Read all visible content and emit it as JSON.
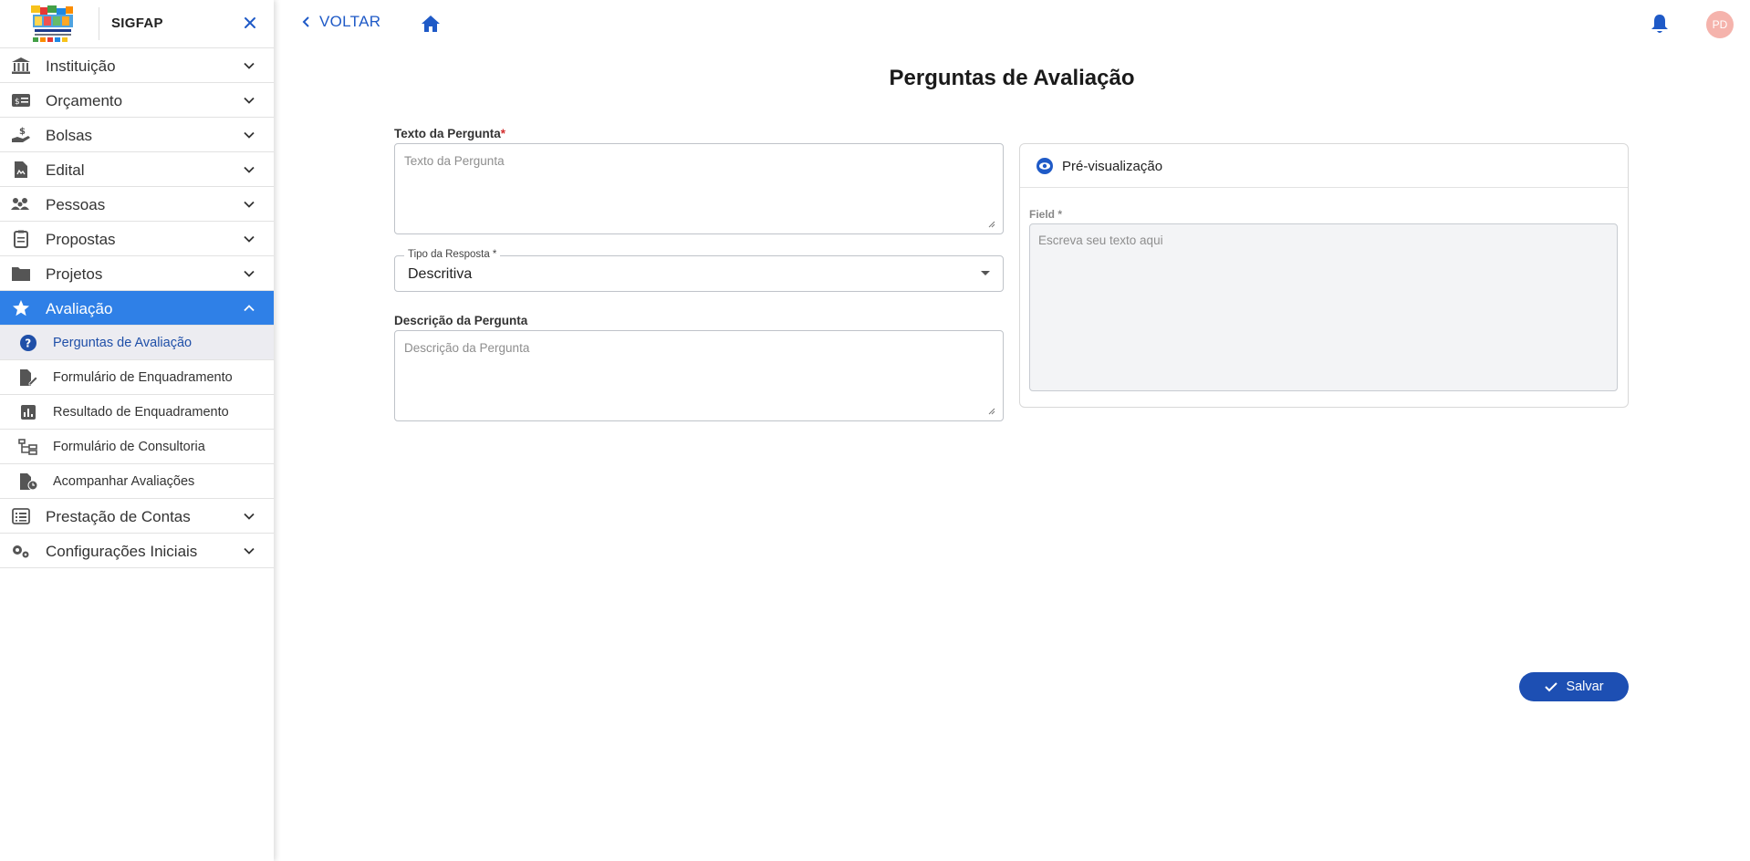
{
  "app": {
    "title": "SIGFAP"
  },
  "sidebar": {
    "items": [
      {
        "label": "Instituição",
        "icon": "institution-icon"
      },
      {
        "label": "Orçamento",
        "icon": "budget-icon"
      },
      {
        "label": "Bolsas",
        "icon": "scholarship-icon"
      },
      {
        "label": "Edital",
        "icon": "document-icon"
      },
      {
        "label": "Pessoas",
        "icon": "people-icon"
      },
      {
        "label": "Propostas",
        "icon": "proposal-icon"
      },
      {
        "label": "Projetos",
        "icon": "folder-icon"
      },
      {
        "label": "Avaliação",
        "icon": "star-icon",
        "active": true
      }
    ],
    "subitems": [
      {
        "label": "Perguntas de Avaliação",
        "icon": "question-icon",
        "active": true
      },
      {
        "label": "Formulário de Enquadramento",
        "icon": "file-edit-icon"
      },
      {
        "label": "Resultado de Enquadramento",
        "icon": "bar-chart-icon"
      },
      {
        "label": "Formulário de Consultoria",
        "icon": "tree-icon"
      },
      {
        "label": "Acompanhar Avaliações",
        "icon": "file-clock-icon"
      }
    ],
    "after_items": [
      {
        "label": "Prestação de Contas",
        "icon": "list-icon"
      },
      {
        "label": "Configurações Iniciais",
        "icon": "gears-icon"
      }
    ]
  },
  "topbar": {
    "back_label": "VOLTAR",
    "avatar_initials": "PD"
  },
  "page": {
    "title": "Perguntas de Avaliação"
  },
  "form": {
    "question_text": {
      "label": "Texto da Pergunta",
      "required_mark": "*",
      "placeholder": "Texto da Pergunta",
      "value": ""
    },
    "answer_type": {
      "label": "Tipo da Resposta *",
      "value": "Descritiva"
    },
    "question_description": {
      "label": "Descrição da Pergunta",
      "placeholder": "Descrição da Pergunta",
      "value": ""
    }
  },
  "preview": {
    "title": "Pré-visualização",
    "field_label": "Field *",
    "placeholder": "Escreva seu texto aqui"
  },
  "actions": {
    "save_label": "Salvar"
  },
  "colors": {
    "accent": "#2f80e7",
    "primary_button": "#1d4fb3",
    "link": "#1f5ac7",
    "avatar": "#f5b3ac",
    "required": "#d32f2f"
  }
}
